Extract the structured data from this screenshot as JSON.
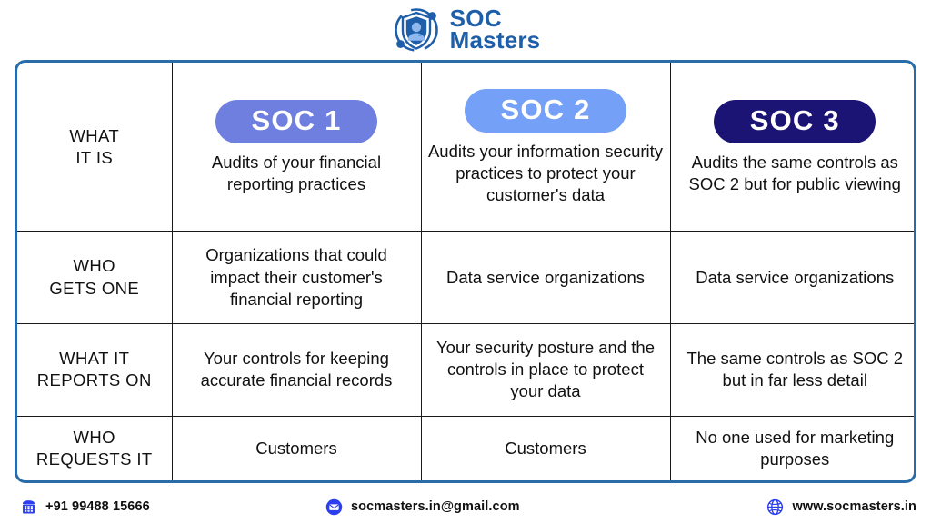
{
  "brand": {
    "logo_icon": "shield-agent-icon",
    "name_line1": "SOC",
    "name_line2": "Masters",
    "logo_color": "#1f5fa9"
  },
  "table": {
    "columns": [
      {
        "id": "label",
        "label": ""
      },
      {
        "id": "soc1",
        "label": "SOC 1",
        "pill_color": "#6f7fe0"
      },
      {
        "id": "soc2",
        "label": "SOC 2",
        "pill_color": "#74a0f7"
      },
      {
        "id": "soc3",
        "label": "SOC 3",
        "pill_color": "#1b1474"
      }
    ],
    "rows": [
      {
        "label": "WHAT\nIT IS",
        "label_line1": "WHAT",
        "label_line2": "IT IS",
        "soc1": "Audits of your financial reporting practices",
        "soc2": "Audits your information security practices to protect your customer's data",
        "soc3": "Audits the same controls as SOC 2 but for public viewing"
      },
      {
        "label_line1": "WHO",
        "label_line2": "GETS ONE",
        "soc1": "Organizations that could impact their customer's financial reporting",
        "soc2": "Data service organizations",
        "soc3": "Data service organizations"
      },
      {
        "label_line1": "WHAT IT",
        "label_line2": "REPORTS ON",
        "soc1": "Your controls for keeping accurate financial records",
        "soc2": "Your security posture and the controls in place to protect your data",
        "soc3": "The same controls as SOC 2 but in far less detail"
      },
      {
        "label_line1": "WHO",
        "label_line2": "REQUESTS IT",
        "soc1": "Customers",
        "soc2": "Customers",
        "soc3": "No one used for marketing purposes"
      }
    ],
    "border_color": "#2a6ca8"
  },
  "footer": {
    "phone": {
      "icon": "telephone-icon",
      "text": "+91 99488 15666"
    },
    "email": {
      "icon": "envelope-icon",
      "text": "socmasters.in@gmail.com"
    },
    "website": {
      "icon": "globe-icon",
      "text": "www.socmasters.in"
    },
    "icon_color": "#2b3ef0"
  }
}
